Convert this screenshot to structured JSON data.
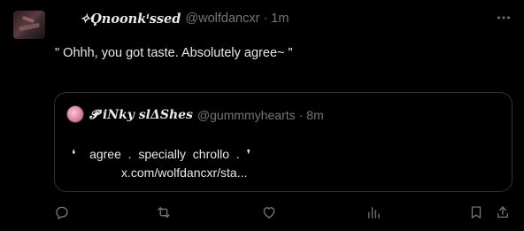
{
  "tweet": {
    "display_name": "✧Ϙnoonkⁱssed",
    "handle": "@wolfdancxr",
    "separator": "·",
    "time": "1m",
    "text": "\" Ohhh, you got taste. Absolutely agree~ \"",
    "more_icon": "more-horizontal-icon"
  },
  "quote": {
    "display_name": "𝓟 iNky slΔShes",
    "handle": "@gummmyhearts",
    "separator": "·",
    "time": "8m",
    "line1": "❛    agree  .  specially  chrollo  .  ❜",
    "line2": "x.com/wolfdancxr/sta..."
  },
  "actions": [
    {
      "name": "reply-icon"
    },
    {
      "name": "retweet-icon"
    },
    {
      "name": "like-icon"
    },
    {
      "name": "views-icon"
    },
    {
      "name": "bookmark-icon"
    },
    {
      "name": "share-icon"
    }
  ],
  "colors": {
    "background": "#000000",
    "text": "#e7e9ea",
    "muted": "#71767b",
    "border": "#2f3336"
  }
}
